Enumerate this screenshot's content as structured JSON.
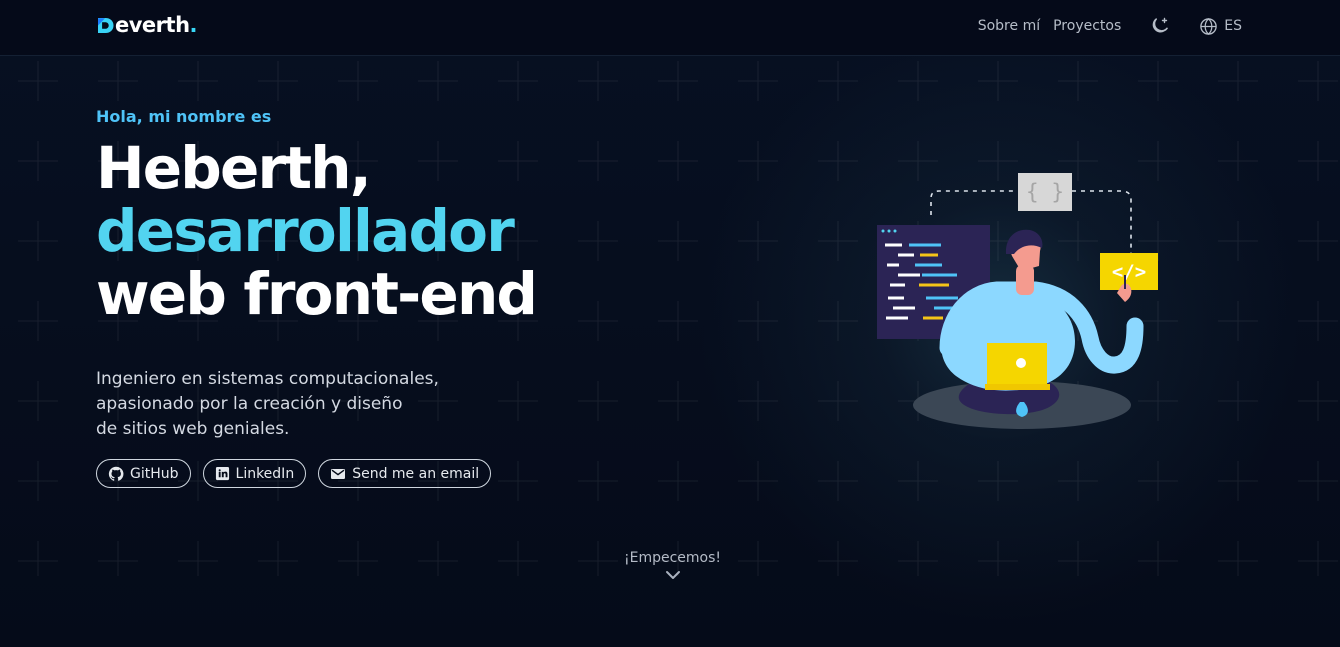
{
  "header": {
    "logo": {
      "text": "everth",
      "dot": "."
    },
    "nav": [
      {
        "label": "Sobre mí"
      },
      {
        "label": "Proyectos"
      }
    ],
    "theme_icon": "moon-sparkle-icon",
    "language_icon": "globe-icon",
    "language": "ES"
  },
  "hero": {
    "intro": "Hola, mi nombre es",
    "headline": {
      "line1": "Heberth,",
      "line2": "desarrollador",
      "line3": "web front-end"
    },
    "description": {
      "line1": "Ingeniero en sistemas computacionales,",
      "line2": "apasionado por la creación y diseño",
      "line3": "de sitios web geniales."
    },
    "buttons": [
      {
        "label": "GitHub",
        "icon": "github-icon"
      },
      {
        "label": "LinkedIn",
        "icon": "linkedin-icon"
      },
      {
        "label": "Send me an email",
        "icon": "mail-icon"
      }
    ],
    "illustration_icons": {
      "curly_braces": "{ }",
      "code_tag": "</>"
    }
  },
  "scroll": {
    "label": "¡Empecemos!",
    "icon": "chevron-down-icon"
  },
  "colors": {
    "background": "#050b19",
    "accent": "#52d4f0",
    "intro": "#4fc3f7",
    "text": "#ffffff",
    "muted": "#b4bbc6",
    "yellow": "#f5c518",
    "screen": "#2b2455"
  }
}
